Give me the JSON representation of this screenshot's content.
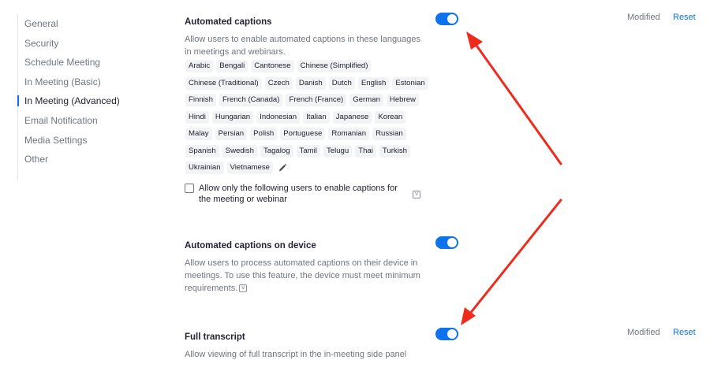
{
  "sidebar": {
    "items": [
      {
        "label": "General"
      },
      {
        "label": "Security"
      },
      {
        "label": "Schedule Meeting"
      },
      {
        "label": "In Meeting (Basic)"
      },
      {
        "label": "In Meeting (Advanced)",
        "active": true
      },
      {
        "label": "Email Notification"
      },
      {
        "label": "Media Settings"
      },
      {
        "label": "Other"
      }
    ]
  },
  "sections": {
    "automated_captions": {
      "title": "Automated captions",
      "description": "Allow users to enable automated captions in these languages in meetings and webinars.",
      "enabled": true,
      "modified": "Modified",
      "reset": "Reset",
      "languages": [
        "Arabic",
        "Bengali",
        "Cantonese",
        "Chinese (Simplified)",
        "Chinese (Traditional)",
        "Czech",
        "Danish",
        "Dutch",
        "English",
        "Estonian",
        "Finnish",
        "French (Canada)",
        "French (France)",
        "German",
        "Hebrew",
        "Hindi",
        "Hungarian",
        "Indonesian",
        "Italian",
        "Japanese",
        "Korean",
        "Malay",
        "Persian",
        "Polish",
        "Portuguese",
        "Romanian",
        "Russian",
        "Spanish",
        "Swedish",
        "Tagalog",
        "Tamil",
        "Telugu",
        "Thai",
        "Turkish",
        "Ukrainian",
        "Vietnamese"
      ],
      "checkbox_label": "Allow only the following users to enable captions for the meeting or webinar",
      "checkbox_checked": false
    },
    "captions_on_device": {
      "title": "Automated captions on device",
      "description": "Allow users to process automated captions on their device in meetings. To use this feature, the device must meet minimum requirements.",
      "enabled": true
    },
    "full_transcript": {
      "title": "Full transcript",
      "description": "Allow viewing of full transcript in the in-meeting side panel",
      "enabled": true,
      "modified": "Modified",
      "reset": "Reset"
    }
  },
  "colors": {
    "accent": "#0e72ed",
    "annotation_arrow": "#ee2b1c"
  },
  "icons": {
    "info": "info-icon",
    "edit": "pencil-icon"
  }
}
